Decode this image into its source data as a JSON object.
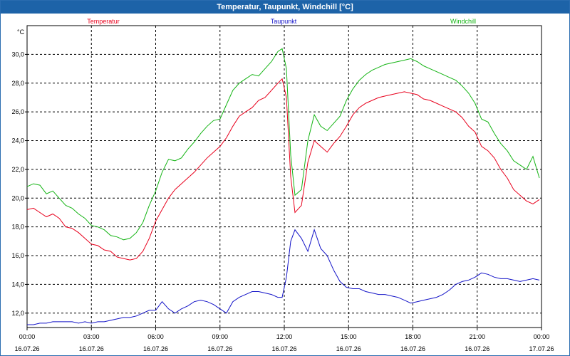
{
  "window": {
    "title": "Temperatur, Taupunkt, Windchill [°C]"
  },
  "chart_data": {
    "type": "line",
    "title": "Temperatur, Taupunkt, Windchill [°C]",
    "ylabel": "°C",
    "ylim": [
      11,
      32
    ],
    "xlim": [
      "16.07.26 00:00",
      "17.07.26 00:00"
    ],
    "grid": true,
    "legend_placement": "top",
    "y_ticks": [
      "12,0",
      "14,0",
      "16,0",
      "18,0",
      "20,0",
      "22,0",
      "24,0",
      "26,0",
      "28,0",
      "30,0"
    ],
    "y_tick_values": [
      12,
      14,
      16,
      18,
      20,
      22,
      24,
      26,
      28,
      30
    ],
    "x_tick_hours": [
      0,
      3,
      6,
      9,
      12,
      15,
      18,
      21,
      24
    ],
    "x_tick_times": [
      "00:00",
      "03:00",
      "06:00",
      "09:00",
      "12:00",
      "15:00",
      "18:00",
      "21:00",
      "00:00"
    ],
    "x_tick_dates": [
      "16.07.26",
      "16.07.26",
      "16.07.26",
      "16.07.26",
      "16.07.26",
      "16.07.26",
      "16.07.26",
      "16.07.26",
      "17.07.26"
    ],
    "series": [
      {
        "name": "Temperatur",
        "color": "#e8001c",
        "x": [
          0,
          0.3,
          0.6,
          0.9,
          1.2,
          1.5,
          1.8,
          2.1,
          2.4,
          2.7,
          3.0,
          3.3,
          3.6,
          3.9,
          4.2,
          4.5,
          4.8,
          5.1,
          5.4,
          5.7,
          6.0,
          6.3,
          6.6,
          6.9,
          7.2,
          7.5,
          7.8,
          8.1,
          8.4,
          8.7,
          9.0,
          9.3,
          9.6,
          9.9,
          10.2,
          10.5,
          10.8,
          11.1,
          11.4,
          11.7,
          11.9,
          12.1,
          12.3,
          12.5,
          12.8,
          13.1,
          13.4,
          13.7,
          14.0,
          14.3,
          14.6,
          14.9,
          15.2,
          15.5,
          15.8,
          16.1,
          16.4,
          16.7,
          17.0,
          17.3,
          17.6,
          17.9,
          18.2,
          18.5,
          18.8,
          19.1,
          19.4,
          19.7,
          20.0,
          20.3,
          20.6,
          20.9,
          21.2,
          21.5,
          21.8,
          22.1,
          22.4,
          22.7,
          23.0,
          23.3,
          23.6,
          23.9
        ],
        "values": [
          19.2,
          19.3,
          19.0,
          18.7,
          18.9,
          18.6,
          18.0,
          17.9,
          17.6,
          17.2,
          16.8,
          16.7,
          16.4,
          16.3,
          15.9,
          15.8,
          15.7,
          15.8,
          16.3,
          17.2,
          18.4,
          19.2,
          20.0,
          20.6,
          21.0,
          21.4,
          21.8,
          22.3,
          22.8,
          23.2,
          23.6,
          24.2,
          25.0,
          25.7,
          26.0,
          26.3,
          26.8,
          27.0,
          27.5,
          28.0,
          28.3,
          27.0,
          21.5,
          19.0,
          19.5,
          22.5,
          24.0,
          23.6,
          23.2,
          23.8,
          24.3,
          25.0,
          25.8,
          26.3,
          26.6,
          26.8,
          27.0,
          27.1,
          27.2,
          27.3,
          27.4,
          27.3,
          27.2,
          26.9,
          26.8,
          26.6,
          26.4,
          26.2,
          26.0,
          25.6,
          25.0,
          24.6,
          23.6,
          23.3,
          22.8,
          22.0,
          21.4,
          20.6,
          20.2,
          19.8,
          19.6,
          19.9
        ]
      },
      {
        "name": "Taupunkt",
        "color": "#1414c8",
        "x": [
          0,
          0.3,
          0.6,
          0.9,
          1.2,
          1.5,
          1.8,
          2.1,
          2.4,
          2.7,
          3.0,
          3.3,
          3.6,
          3.9,
          4.2,
          4.5,
          4.8,
          5.1,
          5.4,
          5.7,
          6.0,
          6.3,
          6.6,
          6.9,
          7.2,
          7.5,
          7.8,
          8.1,
          8.4,
          8.7,
          9.0,
          9.3,
          9.6,
          9.9,
          10.2,
          10.5,
          10.8,
          11.1,
          11.4,
          11.7,
          11.9,
          12.1,
          12.3,
          12.5,
          12.8,
          13.1,
          13.4,
          13.7,
          14.0,
          14.3,
          14.6,
          14.9,
          15.2,
          15.5,
          15.8,
          16.1,
          16.4,
          16.7,
          17.0,
          17.3,
          17.6,
          17.9,
          18.2,
          18.5,
          18.8,
          19.1,
          19.4,
          19.7,
          20.0,
          20.3,
          20.6,
          20.9,
          21.2,
          21.5,
          21.8,
          22.1,
          22.4,
          22.7,
          23.0,
          23.3,
          23.6,
          23.9
        ],
        "values": [
          11.2,
          11.2,
          11.3,
          11.3,
          11.4,
          11.4,
          11.4,
          11.4,
          11.3,
          11.4,
          11.3,
          11.4,
          11.4,
          11.5,
          11.6,
          11.7,
          11.7,
          11.8,
          12.0,
          12.2,
          12.2,
          12.8,
          12.3,
          12.0,
          12.3,
          12.5,
          12.8,
          12.9,
          12.8,
          12.6,
          12.3,
          12.0,
          12.8,
          13.1,
          13.3,
          13.5,
          13.5,
          13.4,
          13.3,
          13.1,
          13.1,
          14.5,
          17.0,
          17.8,
          17.2,
          16.3,
          17.8,
          16.5,
          16.0,
          15.0,
          14.2,
          13.8,
          13.7,
          13.7,
          13.5,
          13.4,
          13.3,
          13.3,
          13.2,
          13.1,
          12.9,
          12.7,
          12.8,
          12.9,
          13.0,
          13.1,
          13.3,
          13.6,
          14.0,
          14.2,
          14.3,
          14.5,
          14.8,
          14.7,
          14.5,
          14.4,
          14.4,
          14.3,
          14.2,
          14.3,
          14.4,
          14.3
        ]
      },
      {
        "name": "Windchill",
        "color": "#14b414",
        "x": [
          0,
          0.3,
          0.6,
          0.9,
          1.2,
          1.5,
          1.8,
          2.1,
          2.4,
          2.7,
          3.0,
          3.3,
          3.6,
          3.9,
          4.2,
          4.5,
          4.8,
          5.1,
          5.4,
          5.7,
          6.0,
          6.3,
          6.6,
          6.9,
          7.2,
          7.5,
          7.8,
          8.1,
          8.4,
          8.7,
          9.0,
          9.3,
          9.6,
          9.9,
          10.2,
          10.5,
          10.8,
          11.1,
          11.4,
          11.7,
          11.9,
          12.1,
          12.3,
          12.5,
          12.8,
          13.1,
          13.4,
          13.7,
          14.0,
          14.3,
          14.6,
          14.9,
          15.2,
          15.5,
          15.8,
          16.1,
          16.4,
          16.7,
          17.0,
          17.3,
          17.6,
          17.9,
          18.2,
          18.5,
          18.8,
          19.1,
          19.4,
          19.7,
          20.0,
          20.3,
          20.6,
          20.9,
          21.2,
          21.5,
          21.8,
          22.1,
          22.4,
          22.7,
          23.0,
          23.3,
          23.6,
          23.9
        ],
        "values": [
          20.8,
          21.0,
          20.9,
          20.3,
          20.5,
          20.0,
          19.5,
          19.3,
          18.9,
          18.6,
          18.1,
          18.0,
          17.8,
          17.4,
          17.3,
          17.1,
          17.2,
          17.6,
          18.3,
          19.5,
          20.5,
          21.8,
          22.7,
          22.6,
          22.8,
          23.4,
          23.9,
          24.5,
          25.0,
          25.4,
          25.5,
          26.5,
          27.5,
          28.0,
          28.3,
          28.6,
          28.5,
          29.0,
          29.5,
          30.2,
          30.4,
          29.0,
          23.0,
          20.2,
          20.6,
          24.0,
          25.8,
          25.0,
          24.7,
          25.2,
          25.7,
          26.8,
          27.6,
          28.2,
          28.6,
          28.9,
          29.1,
          29.3,
          29.4,
          29.5,
          29.6,
          29.7,
          29.5,
          29.2,
          29.0,
          28.8,
          28.6,
          28.4,
          28.2,
          27.8,
          27.3,
          26.6,
          25.5,
          25.3,
          24.5,
          23.8,
          23.3,
          22.6,
          22.3,
          22.0,
          22.9,
          21.4
        ]
      }
    ]
  }
}
